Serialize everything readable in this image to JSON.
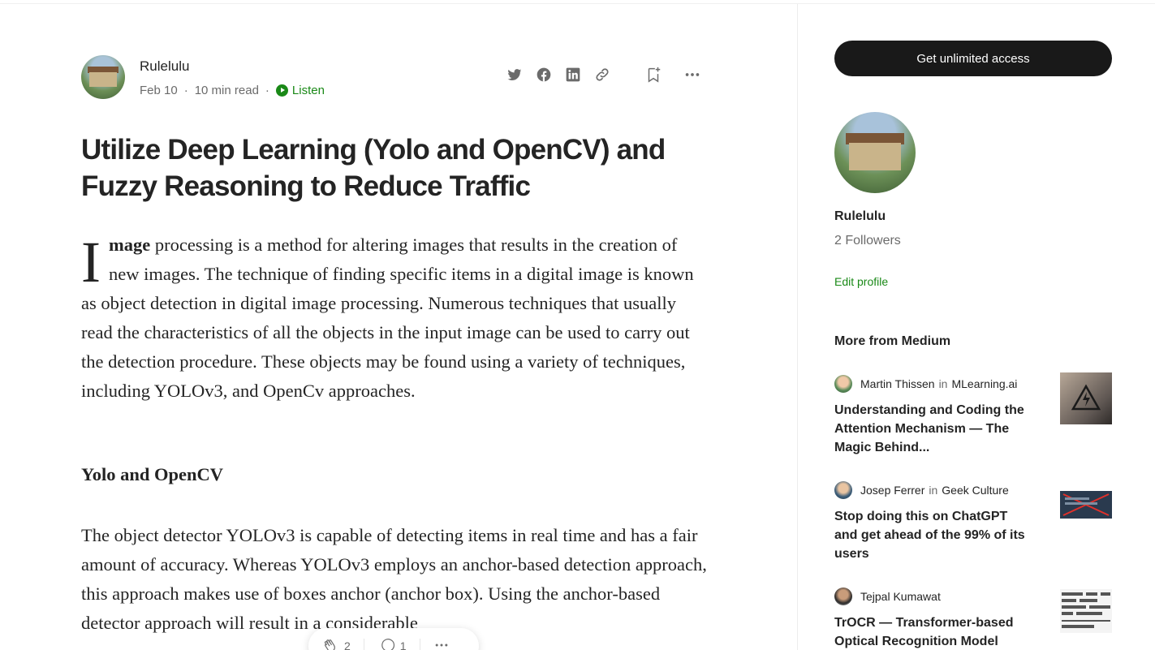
{
  "article": {
    "author": "Rulelulu",
    "date": "Feb 10",
    "read_time": "10 min read",
    "listen_label": "Listen",
    "title": "Utilize Deep Learning (Yolo and OpenCV) and Fuzzy Reasoning to Reduce Traffic",
    "dropcap": "I",
    "lead_word": "mage",
    "para1_rest": " processing is a method for altering images that results in the creation of new images. The technique of finding specific items in a digital image is known as object detection in digital image processing. Numerous techniques that usually read the characteristics of all the objects in the input image can be used to carry out the detection procedure. These objects may be found using a variety of techniques, including YOLOv3, and OpenCv approaches.",
    "subheading": "Yolo and OpenCV",
    "para2": "The object detector YOLOv3 is capable of detecting items in real time and has a fair amount of accuracy. Whereas YOLOv3 employs an anchor-based detection approach, this approach makes use of boxes anchor (anchor box). Using the anchor-based detector approach will result in a considerable"
  },
  "actions": {
    "claps": "2",
    "responses": "1"
  },
  "icons": {
    "share": [
      "twitter-icon",
      "facebook-icon",
      "linkedin-icon",
      "link-icon"
    ],
    "bookmark": "bookmark-add-icon",
    "more": "more-icon",
    "play": "play-icon",
    "clap": "clap-icon",
    "comment": "comment-icon"
  },
  "sidebar": {
    "cta_label": "Get unlimited access",
    "profile_name": "Rulelulu",
    "followers": "2 Followers",
    "edit_profile": "Edit profile",
    "more_heading": "More from Medium",
    "recommendations": [
      {
        "author": "Martin Thissen",
        "in_label": "in",
        "publication": "MLearning.ai",
        "title": "Understanding and Coding the Attention Mechanism — The Magic Behind..."
      },
      {
        "author": "Josep Ferrer",
        "in_label": "in",
        "publication": "Geek Culture",
        "title": "Stop doing this on ChatGPT and get ahead of the 99% of its users"
      },
      {
        "author": "Tejpal Kumawat",
        "in_label": "",
        "publication": "",
        "title": "TrOCR — Transformer-based Optical Recognition Model"
      }
    ]
  },
  "colors": {
    "accent_green": "#1a8917",
    "text_primary": "#242424",
    "text_secondary": "#6b6b6b",
    "cta_bg": "#191919"
  }
}
